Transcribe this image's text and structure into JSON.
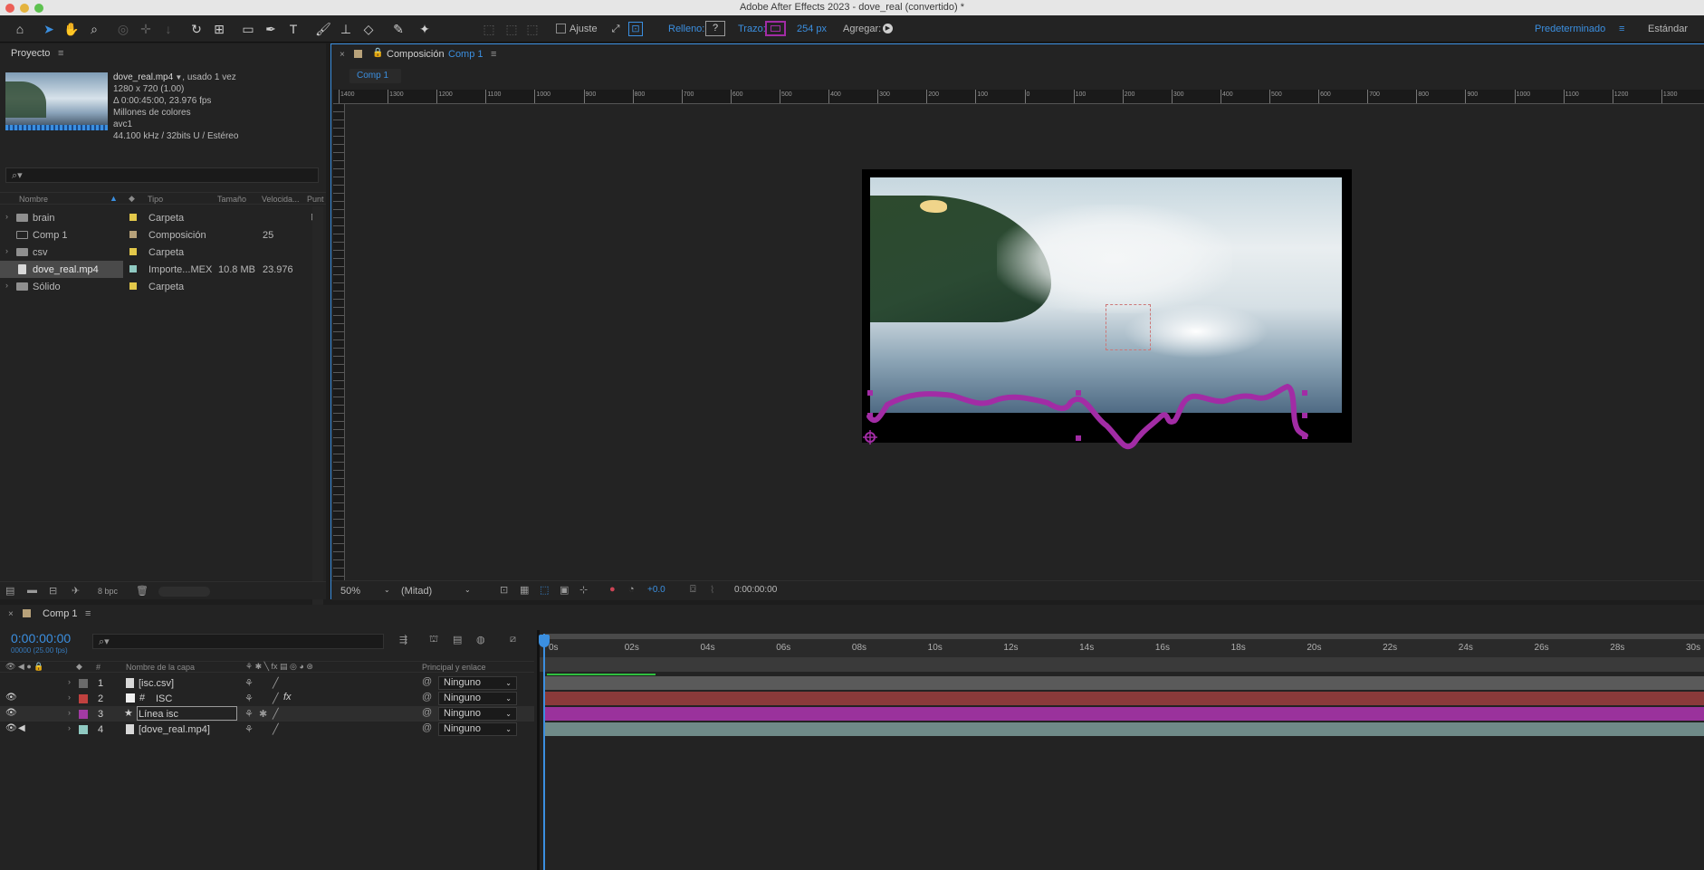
{
  "window": {
    "title": "Adobe After Effects 2023 - dove_real (convertido) *"
  },
  "toolbar": {
    "snap_label": "Ajuste",
    "fill_label": "Relleno:",
    "fill_value": "?",
    "stroke_label": "Trazo:",
    "stroke_width": "254 px",
    "add_label": "Agregar:",
    "workspace_active": "Predeterminado",
    "workspace_other": "Estándar"
  },
  "project": {
    "tab": "Proyecto",
    "asset": {
      "name": "dove_real.mp4",
      "used": ", usado 1 vez",
      "dims": "1280 x 720 (1.00)",
      "duration": "Δ 0:00:45:00, 23.976 fps",
      "colors": "Millones de colores",
      "codec": "avc1",
      "audio": "44.100 kHz / 32bits U / Estéreo"
    },
    "columns": [
      "Nombre",
      "Tipo",
      "Tamaño",
      "Velocida...",
      "Punt"
    ],
    "items": [
      {
        "name": "brain",
        "type": "Carpeta",
        "size": "",
        "rate": "",
        "color": "#e3c84a"
      },
      {
        "name": "Comp 1",
        "type": "Composición",
        "size": "",
        "rate": "25",
        "color": "#b8a27a"
      },
      {
        "name": "csv",
        "type": "Carpeta",
        "size": "",
        "rate": "",
        "color": "#e3c84a"
      },
      {
        "name": "dove_real.mp4",
        "type": "Importe...MEX",
        "size": "10.8 MB",
        "rate": "23.976",
        "color": "#8fc9c1"
      },
      {
        "name": "Sólido",
        "type": "Carpeta",
        "size": "",
        "rate": "",
        "color": "#e3c84a"
      }
    ],
    "bpc": "8 bpc"
  },
  "composition": {
    "panel_label": "Composición",
    "comp_name": "Comp 1",
    "tab": "Comp 1",
    "zoom": "50%",
    "resolution": "(Mitad)",
    "exposure": "+0.0",
    "timecode": "0:00:00:00",
    "ruler_labels": [
      "1400",
      "1300",
      "1200",
      "1100",
      "1000",
      "900",
      "800",
      "700",
      "600",
      "500",
      "400",
      "300",
      "200",
      "100",
      "0",
      "100",
      "200",
      "300",
      "400",
      "500",
      "600",
      "700",
      "800",
      "900",
      "1000",
      "1100",
      "1200",
      "1300"
    ]
  },
  "timeline": {
    "tab": "Comp 1",
    "timecode": "0:00:00:00",
    "frames": "00000 (25.00 fps)",
    "col_layer": "Nombre de la capa",
    "col_parent": "Principal y enlace",
    "col_num": "#",
    "time_marks": [
      "0s",
      "02s",
      "04s",
      "06s",
      "08s",
      "10s",
      "12s",
      "14s",
      "16s",
      "18s",
      "20s",
      "22s",
      "24s",
      "26s",
      "28s",
      "30s"
    ],
    "layers": [
      {
        "num": "1",
        "name": "[isc.csv]",
        "parent": "Ninguno",
        "color": "#6a6a6a",
        "bar": "#5a5a5a"
      },
      {
        "num": "2",
        "name": "ISC",
        "parent": "Ninguno",
        "color": "#c0413f",
        "bar": "#8a3a3a"
      },
      {
        "num": "3",
        "name": "Línea isc",
        "parent": "Ninguno",
        "color": "#a23aa4",
        "bar": "#9a329c"
      },
      {
        "num": "4",
        "name": "[dove_real.mp4]",
        "parent": "Ninguno",
        "color": "#8fc9c1",
        "bar": "#6f8a88"
      }
    ]
  },
  "colors": {
    "accent": "#3b8fe0",
    "stroke": "#a22ca5",
    "panel": "#232323"
  }
}
